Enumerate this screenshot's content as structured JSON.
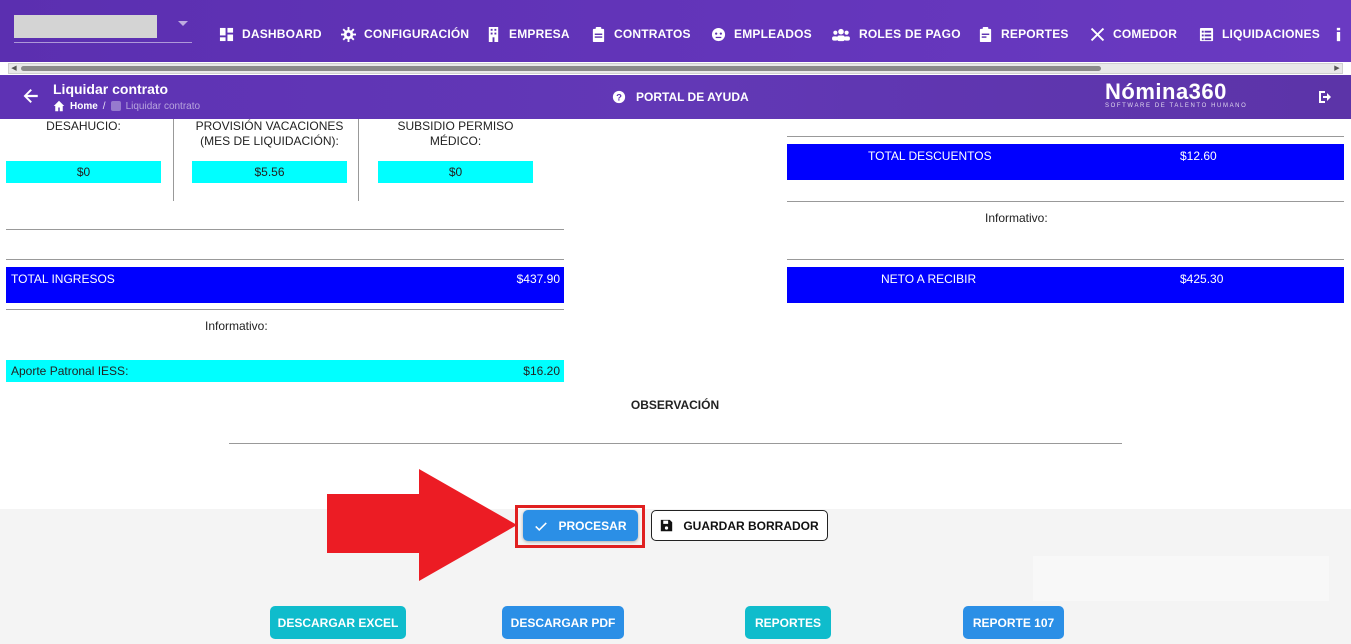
{
  "topnav": {
    "items": [
      {
        "label": "DASHBOARD",
        "icon": "dashboard-icon"
      },
      {
        "label": "CONFIGURACIÓN",
        "icon": "gear-icon"
      },
      {
        "label": "EMPRESA",
        "icon": "building-icon"
      },
      {
        "label": "CONTRATOS",
        "icon": "clipboard-icon"
      },
      {
        "label": "EMPLEADOS",
        "icon": "face-icon"
      },
      {
        "label": "ROLES DE PAGO",
        "icon": "group-icon"
      },
      {
        "label": "REPORTES",
        "icon": "report-icon"
      },
      {
        "label": "COMEDOR",
        "icon": "utensils-icon"
      },
      {
        "label": "LIQUIDACIONES",
        "icon": "list-icon"
      }
    ]
  },
  "subbar": {
    "title": "Liquidar contrato",
    "breadcrumb_home": "Home",
    "breadcrumb_sep": "/",
    "breadcrumb_current": "Liquidar contrato",
    "help_label": "PORTAL DE AYUDA",
    "logo_main": "Nómina360",
    "logo_sub": "SOFTWARE DE TALENTO HUMANO"
  },
  "left": {
    "desahucio_label": "DESAHUCIO:",
    "desahucio_value": "$0",
    "provision_label_1": "PROVISIÓN VACACIONES",
    "provision_label_2": "(MES DE LIQUIDACIÓN):",
    "provision_value": "$5.56",
    "subsidio_label_1": "SUBSIDIO PERMISO",
    "subsidio_label_2": "MÉDICO:",
    "subsidio_value": "$0",
    "total_ingresos_label": "TOTAL INGRESOS",
    "total_ingresos_value": "$437.90",
    "informativo_label": "Informativo:",
    "aporte_label": "Aporte Patronal IESS:",
    "aporte_value": "$16.20"
  },
  "right": {
    "total_descuentos_label": "TOTAL DESCUENTOS",
    "total_descuentos_value": "$12.60",
    "informativo_label": "Informativo:",
    "neto_label": "NETO A RECIBIR",
    "neto_value": "$425.30"
  },
  "observacion_label": "OBSERVACIÓN",
  "actions": {
    "procesar": "PROCESAR",
    "guardar_borrador": "GUARDAR BORRADOR",
    "descargar_excel": "DESCARGAR EXCEL",
    "descargar_pdf": "DESCARGAR PDF",
    "reportes": "REPORTES",
    "reporte_107": "REPORTE 107"
  },
  "colors": {
    "nav_purple": "#5b2fb0",
    "total_blue": "#0000ff",
    "cyan": "#00ffff",
    "primary_button": "#2b8fe6",
    "teal_button": "#0fbccc",
    "annotation_red": "#e02020"
  }
}
